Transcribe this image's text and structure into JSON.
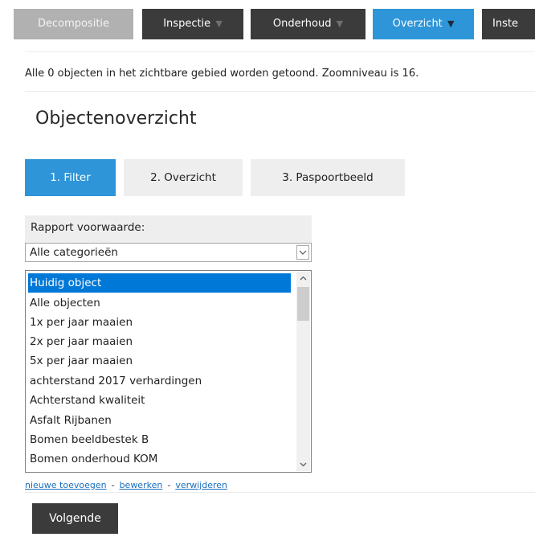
{
  "menu": {
    "decompositie": "Decompositie",
    "inspectie": "Inspectie",
    "onderhoud": "Onderhoud",
    "overzicht": "Overzicht",
    "instellingen": "Inste",
    "arrow": "▼"
  },
  "status_text": "Alle 0 objecten in het zichtbare gebied worden getoond. Zoomniveau is 16.",
  "page_title": "Objectenoverzicht",
  "tabs": [
    {
      "label": "1. Filter"
    },
    {
      "label": "2. Overzicht"
    },
    {
      "label": "3. Paspoortbeeld"
    }
  ],
  "filter": {
    "label": "Rapport voorwaarde:",
    "category_value": "Alle categorieën",
    "items": [
      "Huidig object",
      "Alle objecten",
      "1x per jaar maaien",
      "2x per jaar maaien",
      "5x per jaar maaien",
      "achterstand 2017 verhardingen",
      "Achterstand kwaliteit",
      "Asfalt Rijbanen",
      "Bomen beeldbestek B",
      "Bomen onderhoud KOM"
    ],
    "selected_item": "Huidig object"
  },
  "links": {
    "add": "nieuwe toevoegen",
    "edit": "bewerken",
    "delete": "verwijderen",
    "separator": "-"
  },
  "next_button": "Volgende",
  "colors": {
    "accent": "#2d95d8",
    "dark_button": "#3b3b3b",
    "disabled_button": "#b1b1b1",
    "selection": "#0078d7"
  }
}
